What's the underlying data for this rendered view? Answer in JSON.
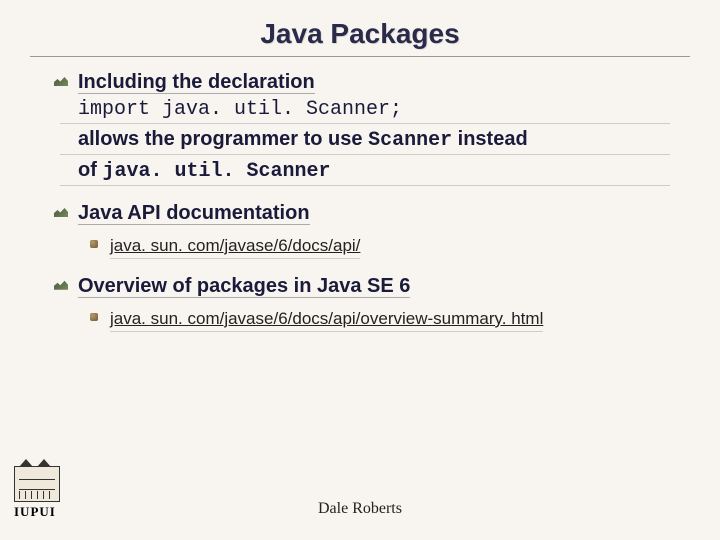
{
  "title": "Java Packages",
  "b1": {
    "line1": "Including the declaration",
    "line2": "import java. util. Scanner;",
    "line3a": "allows the programmer to use ",
    "line3b": "Scanner",
    "line3c": " instead",
    "line4a": "of ",
    "line4b": "java. util. Scanner"
  },
  "b2": {
    "text": "Java API documentation",
    "link": "java. sun. com/javase/6/docs/api/"
  },
  "b3": {
    "text": "Overview of packages in Java SE 6",
    "link": "java. sun. com/javase/6/docs/api/overview-summary. html"
  },
  "footer": "Dale Roberts",
  "logo": "IUPUI"
}
